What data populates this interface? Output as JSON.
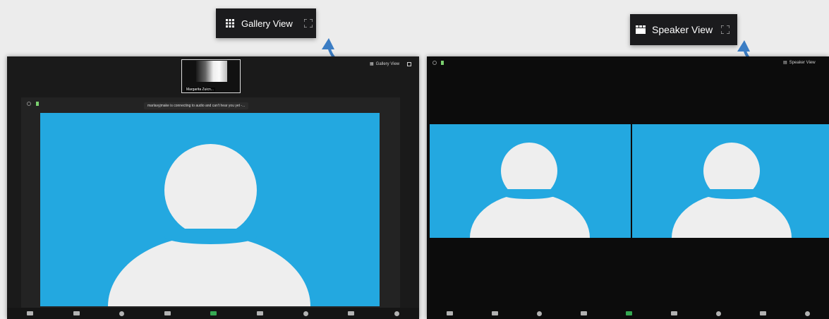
{
  "callouts": {
    "gallery": {
      "label": "Gallery View",
      "icon": "grid-icon"
    },
    "speaker": {
      "label": "Speaker View",
      "icon": "speaker-view-icon"
    }
  },
  "left_window": {
    "view_button_label": "Gallery View",
    "thumbnail_name": "Margarita Zuicn...",
    "notice": "marlavyjmake is connecting to audio and can't hear you yet -..."
  },
  "right_window": {
    "view_button_label": "Speaker View"
  },
  "colors": {
    "tile_blue": "#23a8e0",
    "avatar": "#eeeeee",
    "window_bg": "#1a1a1a",
    "arrow": "#3b7dc4"
  }
}
